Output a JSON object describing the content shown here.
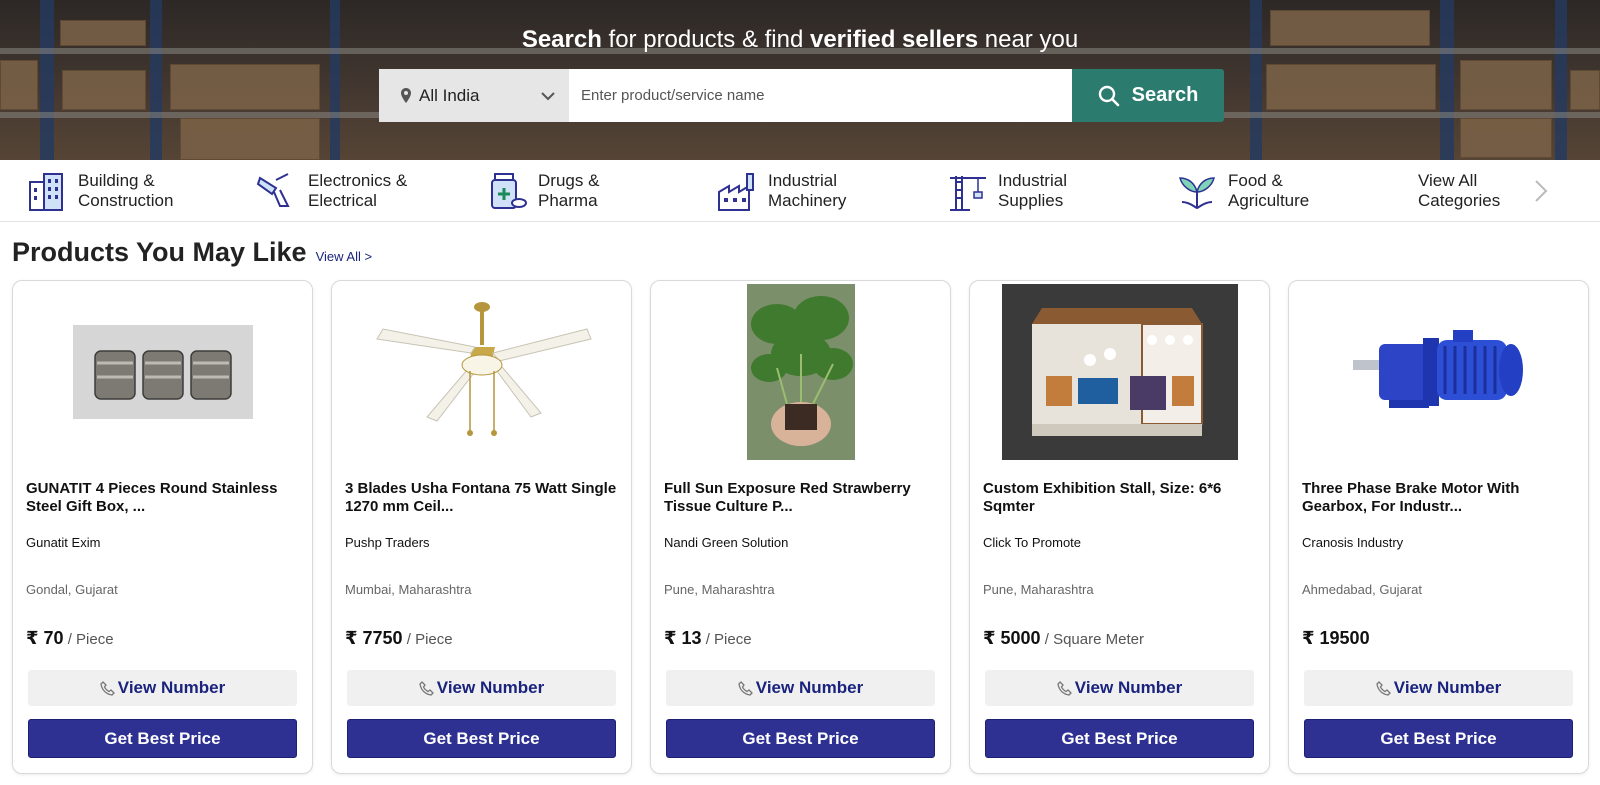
{
  "hero": {
    "title_bold1": "Search",
    "title_mid": " for products & find ",
    "title_bold2": "verified sellers",
    "title_end": " near you",
    "location": "All India",
    "search_placeholder": "Enter product/service name",
    "search_button": "Search"
  },
  "categories": [
    {
      "label": "Building &\nConstruction",
      "icon": "building-icon"
    },
    {
      "label": "Electronics &\nElectrical",
      "icon": "drill-icon"
    },
    {
      "label": "Drugs &\nPharma",
      "icon": "medicine-icon"
    },
    {
      "label": "Industrial\nMachinery",
      "icon": "factory-icon"
    },
    {
      "label": "Industrial\nSupplies",
      "icon": "crane-icon"
    },
    {
      "label": "Food &\nAgriculture",
      "icon": "plant-icon"
    },
    {
      "label": "View All\nCategories",
      "icon": ""
    }
  ],
  "section": {
    "title": "Products You May Like",
    "view_all": "View All >"
  },
  "products": [
    {
      "name": "GUNATIT 4 Pieces Round Stainless Steel Gift Box, ...",
      "seller": "Gunatit Exim",
      "location": "Gondal, Gujarat",
      "price": "₹ 70",
      "unit": " / Piece",
      "view_number": "View Number",
      "cta": "Get Best Price"
    },
    {
      "name": "3 Blades Usha Fontana 75 Watt Single 1270 mm Ceil...",
      "seller": "Pushp Traders",
      "location": "Mumbai, Maharashtra",
      "price": "₹ 7750",
      "unit": " / Piece",
      "view_number": "View Number",
      "cta": "Get Best Price"
    },
    {
      "name": "Full Sun Exposure Red Strawberry Tissue Culture P...",
      "seller": "Nandi Green Solution",
      "location": "Pune, Maharashtra",
      "price": "₹ 13",
      "unit": " / Piece",
      "view_number": "View Number",
      "cta": "Get Best Price"
    },
    {
      "name": "Custom Exhibition Stall, Size: 6*6 Sqmter",
      "seller": "Click To Promote",
      "location": "Pune, Maharashtra",
      "price": "₹ 5000",
      "unit": " / Square Meter",
      "view_number": "View Number",
      "cta": "Get Best Price"
    },
    {
      "name": "Three Phase Brake Motor With Gearbox, For Industr...",
      "seller": "Cranosis Industry",
      "location": "Ahmedabad, Gujarat",
      "price": "₹ 19500",
      "unit": "",
      "view_number": "View Number",
      "cta": "Get Best Price"
    }
  ],
  "colors": {
    "accent": "#2e3192",
    "search_green": "#2b7c6f",
    "link": "#1a237e"
  }
}
